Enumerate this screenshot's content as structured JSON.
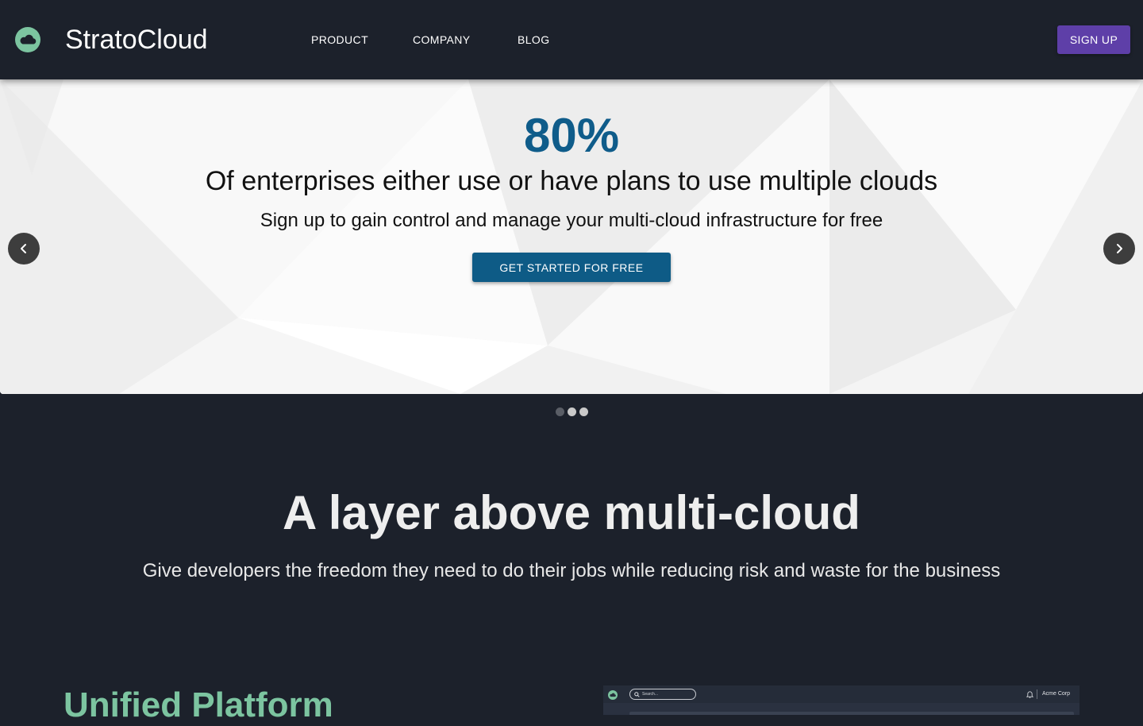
{
  "header": {
    "brand": "StratoCloud",
    "nav": {
      "product": "PRODUCT",
      "company": "COMPANY",
      "blog": "BLOG"
    },
    "signup_label": "SIGN UP",
    "brand_color": "#7cc4a0",
    "signup_color": "#5e3fa8"
  },
  "hero": {
    "stat": "80%",
    "title": "Of enterprises either use or have plans to use multiple clouds",
    "subtitle": "Sign up to gain control and manage your multi-cloud infrastructure for free",
    "cta_label": "GET STARTED FOR FREE",
    "stat_color": "#0f5c8a",
    "cta_color": "#0e5b86",
    "active_slide": 1,
    "slide_count": 3
  },
  "section": {
    "title": "A layer above multi-cloud",
    "subtitle": "Give developers the freedom they need to do their jobs while reducing risk and waste for the business"
  },
  "feature": {
    "title": "Unified Platform",
    "title_color": "#7cc4a0"
  },
  "preview": {
    "search_placeholder": "Search...",
    "org_name": "Acme Corp"
  },
  "icons": {
    "logo": "cloud-icon",
    "prev": "chevron-left-icon",
    "next": "chevron-right-icon",
    "search": "search-icon",
    "bell": "bell-icon"
  }
}
